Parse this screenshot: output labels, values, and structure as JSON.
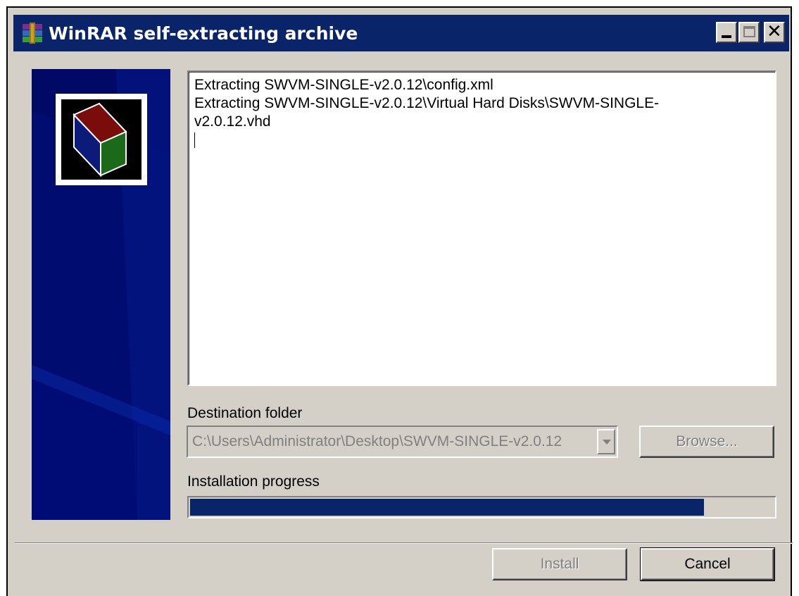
{
  "window": {
    "title": "WinRAR self-extracting archive"
  },
  "log": {
    "lines": [
      "Extracting SWVM-SINGLE-v2.0.12\\config.xml",
      "Extracting SWVM-SINGLE-v2.0.12\\Virtual Hard Disks\\SWVM-SINGLE-v2.0.12.vhd"
    ]
  },
  "destination": {
    "label": "Destination folder",
    "value": "C:\\Users\\Administrator\\Desktop\\SWVM-SINGLE-v2.0.12",
    "browse_label": "Browse..."
  },
  "progress": {
    "label": "Installation progress",
    "value_percent": 88
  },
  "buttons": {
    "install_label": "Install",
    "cancel_label": "Cancel"
  },
  "colors": {
    "titlebar": "#0a246a",
    "progress_fill": "#0a246a",
    "side_panel": "#000c70",
    "dialog_bg": "#d4d0c8"
  },
  "icons": {
    "title": "winrar-app-icon",
    "logo": "archive-box-icon"
  }
}
